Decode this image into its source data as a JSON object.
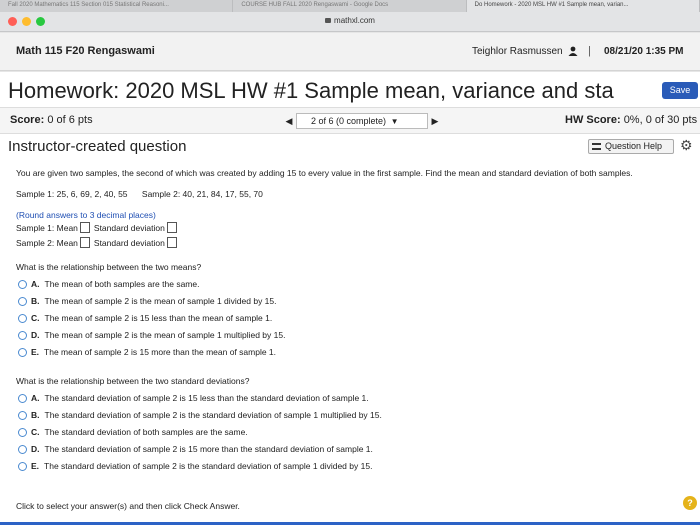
{
  "browser": {
    "tabs": [
      "Fall 2020 Mathematics 115 Section 015 Statistical Reasoni...",
      "COURSE HUB FALL 2020 Rengaswami - Google Docs",
      "Do Homework - 2020 MSL HW #1 Sample mean, varian..."
    ],
    "url": "mathxl.com",
    "colors": {
      "close": "#ff5f57",
      "minimize": "#febc2e",
      "zoom": "#28c840"
    }
  },
  "course": {
    "name": "Math 115 F20 Rengaswami",
    "user": "Teighlor Rasmussen",
    "separator": "|",
    "datetime": "08/21/20 1:35 PM"
  },
  "homework": {
    "title": "Homework: 2020 MSL HW #1 Sample mean, variance and sta",
    "save_label": "Save"
  },
  "scorebar": {
    "score_label": "Score:",
    "score_value": "0 of 6 pts",
    "question_picker": "2 of 6 (0 complete)",
    "hw_label": "HW Score:",
    "hw_value": "0%, 0 of 30 pts"
  },
  "question": {
    "type": "Instructor-created question",
    "help_label": "Question Help",
    "prompt": "You are given two samples, the second of which was created by adding 15 to every value in the first sample. Find the mean and standard deviation of both samples.",
    "sample1": "Sample 1: 25, 6, 69, 2, 40, 55",
    "sample2": "Sample 2: 40, 21, 84, 17, 55, 70",
    "hint": "(Round answers to 3 decimal places)",
    "rows": [
      {
        "mean_label": "Sample 1: Mean",
        "sd_label": "Standard deviation"
      },
      {
        "mean_label": "Sample 2: Mean",
        "sd_label": "Standard deviation"
      }
    ],
    "q1": "What is the relationship between the two means?",
    "q1_options": [
      {
        "letter": "A.",
        "text": "The mean of both samples are the same."
      },
      {
        "letter": "B.",
        "text": "The mean of sample 2 is the mean of sample 1 divided by 15."
      },
      {
        "letter": "C.",
        "text": "The mean of sample 2 is 15 less than the mean of sample 1."
      },
      {
        "letter": "D.",
        "text": "The mean of sample 2 is the mean of sample 1 multiplied by 15."
      },
      {
        "letter": "E.",
        "text": "The mean of sample 2 is 15 more than the mean of sample 1."
      }
    ],
    "q2": "What is the relationship between the two standard deviations?",
    "q2_options": [
      {
        "letter": "A.",
        "text": "The standard deviation of sample 2 is 15 less than the standard deviation of sample 1."
      },
      {
        "letter": "B.",
        "text": "The standard deviation of sample 2 is the standard deviation of sample 1 multiplied by 15."
      },
      {
        "letter": "C.",
        "text": "The standard deviation of both samples are the same."
      },
      {
        "letter": "D.",
        "text": "The standard deviation of sample 2 is 15 more than the standard deviation of sample 1."
      },
      {
        "letter": "E.",
        "text": "The standard deviation of sample 2 is the standard deviation of sample 1 divided by 15."
      }
    ],
    "footer": "Click to select your answer(s) and then click Check Answer.",
    "help_glyph": "?"
  }
}
